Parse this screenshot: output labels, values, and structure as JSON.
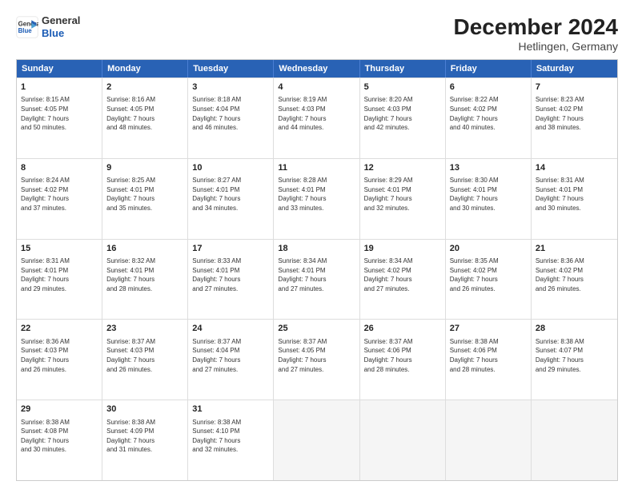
{
  "header": {
    "logo_line1": "General",
    "logo_line2": "Blue",
    "title": "December 2024",
    "subtitle": "Hetlingen, Germany"
  },
  "days_of_week": [
    "Sunday",
    "Monday",
    "Tuesday",
    "Wednesday",
    "Thursday",
    "Friday",
    "Saturday"
  ],
  "weeks": [
    [
      {
        "day": "1",
        "lines": [
          "Sunrise: 8:15 AM",
          "Sunset: 4:05 PM",
          "Daylight: 7 hours",
          "and 50 minutes."
        ]
      },
      {
        "day": "2",
        "lines": [
          "Sunrise: 8:16 AM",
          "Sunset: 4:05 PM",
          "Daylight: 7 hours",
          "and 48 minutes."
        ]
      },
      {
        "day": "3",
        "lines": [
          "Sunrise: 8:18 AM",
          "Sunset: 4:04 PM",
          "Daylight: 7 hours",
          "and 46 minutes."
        ]
      },
      {
        "day": "4",
        "lines": [
          "Sunrise: 8:19 AM",
          "Sunset: 4:03 PM",
          "Daylight: 7 hours",
          "and 44 minutes."
        ]
      },
      {
        "day": "5",
        "lines": [
          "Sunrise: 8:20 AM",
          "Sunset: 4:03 PM",
          "Daylight: 7 hours",
          "and 42 minutes."
        ]
      },
      {
        "day": "6",
        "lines": [
          "Sunrise: 8:22 AM",
          "Sunset: 4:02 PM",
          "Daylight: 7 hours",
          "and 40 minutes."
        ]
      },
      {
        "day": "7",
        "lines": [
          "Sunrise: 8:23 AM",
          "Sunset: 4:02 PM",
          "Daylight: 7 hours",
          "and 38 minutes."
        ]
      }
    ],
    [
      {
        "day": "8",
        "lines": [
          "Sunrise: 8:24 AM",
          "Sunset: 4:02 PM",
          "Daylight: 7 hours",
          "and 37 minutes."
        ]
      },
      {
        "day": "9",
        "lines": [
          "Sunrise: 8:25 AM",
          "Sunset: 4:01 PM",
          "Daylight: 7 hours",
          "and 35 minutes."
        ]
      },
      {
        "day": "10",
        "lines": [
          "Sunrise: 8:27 AM",
          "Sunset: 4:01 PM",
          "Daylight: 7 hours",
          "and 34 minutes."
        ]
      },
      {
        "day": "11",
        "lines": [
          "Sunrise: 8:28 AM",
          "Sunset: 4:01 PM",
          "Daylight: 7 hours",
          "and 33 minutes."
        ]
      },
      {
        "day": "12",
        "lines": [
          "Sunrise: 8:29 AM",
          "Sunset: 4:01 PM",
          "Daylight: 7 hours",
          "and 32 minutes."
        ]
      },
      {
        "day": "13",
        "lines": [
          "Sunrise: 8:30 AM",
          "Sunset: 4:01 PM",
          "Daylight: 7 hours",
          "and 30 minutes."
        ]
      },
      {
        "day": "14",
        "lines": [
          "Sunrise: 8:31 AM",
          "Sunset: 4:01 PM",
          "Daylight: 7 hours",
          "and 30 minutes."
        ]
      }
    ],
    [
      {
        "day": "15",
        "lines": [
          "Sunrise: 8:31 AM",
          "Sunset: 4:01 PM",
          "Daylight: 7 hours",
          "and 29 minutes."
        ]
      },
      {
        "day": "16",
        "lines": [
          "Sunrise: 8:32 AM",
          "Sunset: 4:01 PM",
          "Daylight: 7 hours",
          "and 28 minutes."
        ]
      },
      {
        "day": "17",
        "lines": [
          "Sunrise: 8:33 AM",
          "Sunset: 4:01 PM",
          "Daylight: 7 hours",
          "and 27 minutes."
        ]
      },
      {
        "day": "18",
        "lines": [
          "Sunrise: 8:34 AM",
          "Sunset: 4:01 PM",
          "Daylight: 7 hours",
          "and 27 minutes."
        ]
      },
      {
        "day": "19",
        "lines": [
          "Sunrise: 8:34 AM",
          "Sunset: 4:02 PM",
          "Daylight: 7 hours",
          "and 27 minutes."
        ]
      },
      {
        "day": "20",
        "lines": [
          "Sunrise: 8:35 AM",
          "Sunset: 4:02 PM",
          "Daylight: 7 hours",
          "and 26 minutes."
        ]
      },
      {
        "day": "21",
        "lines": [
          "Sunrise: 8:36 AM",
          "Sunset: 4:02 PM",
          "Daylight: 7 hours",
          "and 26 minutes."
        ]
      }
    ],
    [
      {
        "day": "22",
        "lines": [
          "Sunrise: 8:36 AM",
          "Sunset: 4:03 PM",
          "Daylight: 7 hours",
          "and 26 minutes."
        ]
      },
      {
        "day": "23",
        "lines": [
          "Sunrise: 8:37 AM",
          "Sunset: 4:03 PM",
          "Daylight: 7 hours",
          "and 26 minutes."
        ]
      },
      {
        "day": "24",
        "lines": [
          "Sunrise: 8:37 AM",
          "Sunset: 4:04 PM",
          "Daylight: 7 hours",
          "and 27 minutes."
        ]
      },
      {
        "day": "25",
        "lines": [
          "Sunrise: 8:37 AM",
          "Sunset: 4:05 PM",
          "Daylight: 7 hours",
          "and 27 minutes."
        ]
      },
      {
        "day": "26",
        "lines": [
          "Sunrise: 8:37 AM",
          "Sunset: 4:06 PM",
          "Daylight: 7 hours",
          "and 28 minutes."
        ]
      },
      {
        "day": "27",
        "lines": [
          "Sunrise: 8:38 AM",
          "Sunset: 4:06 PM",
          "Daylight: 7 hours",
          "and 28 minutes."
        ]
      },
      {
        "day": "28",
        "lines": [
          "Sunrise: 8:38 AM",
          "Sunset: 4:07 PM",
          "Daylight: 7 hours",
          "and 29 minutes."
        ]
      }
    ],
    [
      {
        "day": "29",
        "lines": [
          "Sunrise: 8:38 AM",
          "Sunset: 4:08 PM",
          "Daylight: 7 hours",
          "and 30 minutes."
        ]
      },
      {
        "day": "30",
        "lines": [
          "Sunrise: 8:38 AM",
          "Sunset: 4:09 PM",
          "Daylight: 7 hours",
          "and 31 minutes."
        ]
      },
      {
        "day": "31",
        "lines": [
          "Sunrise: 8:38 AM",
          "Sunset: 4:10 PM",
          "Daylight: 7 hours",
          "and 32 minutes."
        ]
      },
      null,
      null,
      null,
      null
    ]
  ]
}
